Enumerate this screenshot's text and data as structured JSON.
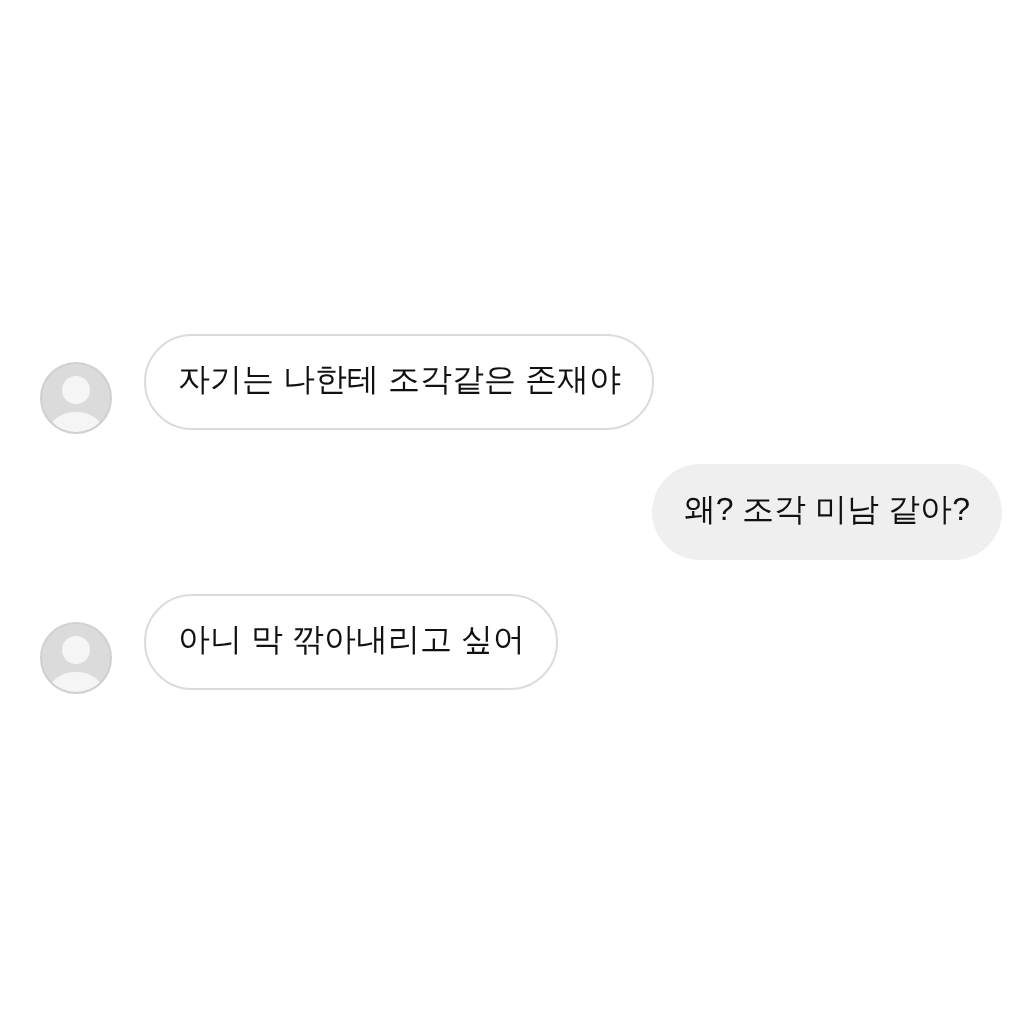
{
  "messages": [
    {
      "kind": "received",
      "text": "자기는 나한테 조각같은 존재야"
    },
    {
      "kind": "sent",
      "text": "왜? 조각 미남 같아?"
    },
    {
      "kind": "received",
      "text": "아니 막 깎아내리고 싶어"
    }
  ]
}
